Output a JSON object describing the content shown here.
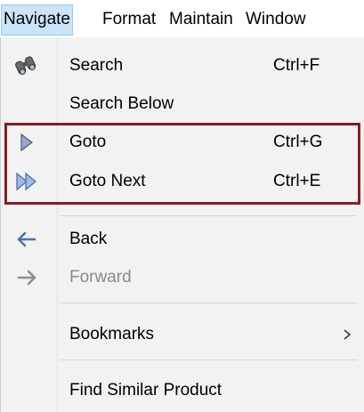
{
  "menubar": {
    "items": [
      {
        "label": "Navigate",
        "active": true
      },
      {
        "label": "Format",
        "active": false
      },
      {
        "label": "Maintain",
        "active": false
      },
      {
        "label": "Window",
        "active": false
      }
    ]
  },
  "menu": {
    "items": [
      {
        "label": "Search",
        "shortcut": "Ctrl+F",
        "icon": "binoculars-icon",
        "enabled": true
      },
      {
        "label": "Search Below",
        "shortcut": "",
        "icon": "",
        "enabled": true
      },
      {
        "label": "Goto",
        "shortcut": "Ctrl+G",
        "icon": "play-arrow-icon",
        "enabled": true
      },
      {
        "label": "Goto Next",
        "shortcut": "Ctrl+E",
        "icon": "double-arrow-icon",
        "enabled": true
      },
      {
        "label": "Back",
        "shortcut": "",
        "icon": "arrow-left-icon",
        "enabled": true
      },
      {
        "label": "Forward",
        "shortcut": "",
        "icon": "arrow-right-icon",
        "enabled": false
      },
      {
        "label": "Bookmarks",
        "shortcut": "",
        "icon": "chevron-right-icon",
        "enabled": true
      },
      {
        "label": "Find Similar Product",
        "shortcut": "",
        "icon": "",
        "enabled": true
      }
    ]
  },
  "colors": {
    "menubar_active_bg": "#cce4f7",
    "menu_bg": "#f2f2f2",
    "highlight_border": "#8b1a22",
    "disabled_text": "#8a8a8a"
  }
}
